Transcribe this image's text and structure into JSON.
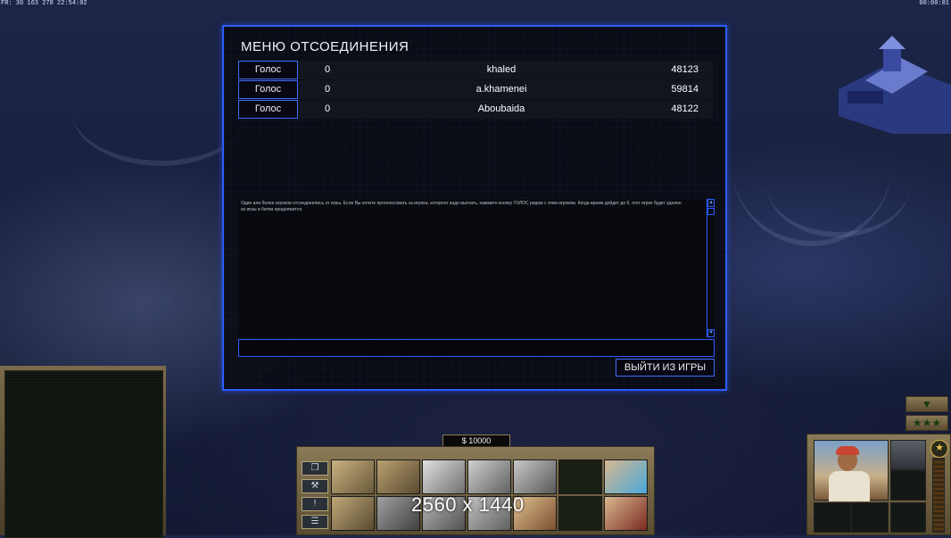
{
  "hud": {
    "top_left": "FR: 30 163 278 22:54:02",
    "top_right": "00:00:01"
  },
  "dialog": {
    "title": "МЕНЮ ОТСОЕДИНЕНИЯ",
    "players": [
      {
        "vote_label": "Голос",
        "votes": "0",
        "name": "khaled",
        "id": "48123"
      },
      {
        "vote_label": "Голос",
        "votes": "0",
        "name": "a.khamenei",
        "id": "59814"
      },
      {
        "vote_label": "Голос",
        "votes": "0",
        "name": "Aboubaida",
        "id": "48122"
      }
    ],
    "message": "Один или более игроков отсоединились от игры. Если Вы хотите проголосовать за игрока, которого надо выгнать, нажмите кнопку ГОЛОС рядом с этим игроком. Когда время дойдет до 0, этот игрок будет удален из игры и битва продолжится.",
    "chat_value": "",
    "quit_label": "ВЫЙТИ ИЗ ИГРЫ"
  },
  "command_bar": {
    "money": "$ 10000",
    "resolution_overlay": "2560 x 1440",
    "side_buttons": [
      {
        "icon": "window-icon",
        "glyph": "❐"
      },
      {
        "icon": "wrench-icon",
        "glyph": "⚒"
      },
      {
        "icon": "alert-icon",
        "glyph": "!"
      },
      {
        "icon": "menu-icon",
        "glyph": "☰"
      }
    ]
  },
  "unit_panel": {
    "rank_up_glyph": "▼",
    "rank_stars": "★★★",
    "star_glyph": "★"
  },
  "colors": {
    "accent": "#2a5cff",
    "panel_gold": "#8a7a56"
  }
}
